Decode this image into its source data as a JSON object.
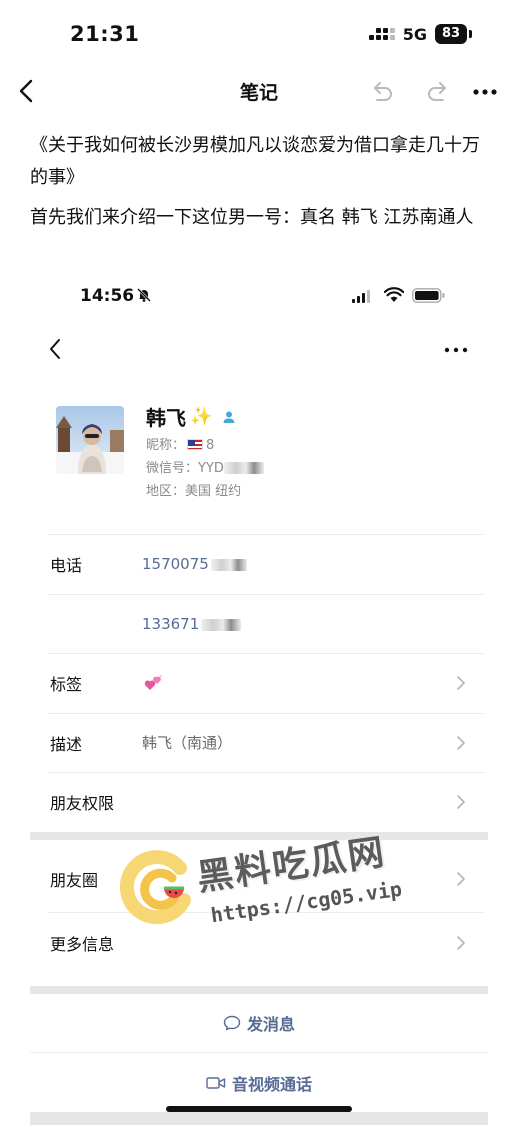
{
  "status_bar": {
    "time": "21:31",
    "network": "5G",
    "battery": "83"
  },
  "nav": {
    "title": "笔记"
  },
  "note": {
    "line1": "《关于我如何被长沙男模加凡以谈恋爱为借口拿走几十万的事》",
    "line2": "首先我们来介绍一下这位男一号：真名 韩飞 江苏南通人"
  },
  "inner_status": {
    "time": "14:56"
  },
  "profile": {
    "name": "韩飞",
    "sparkle": "✨",
    "nickname_label": "昵称：",
    "nickname_value": "8",
    "wechat_label": "微信号：",
    "wechat_value": "YYD",
    "region_label": "地区：",
    "region_value": "美国 纽约"
  },
  "rows": {
    "phone_label": "电话",
    "phone1": "1570075",
    "phone2": "133671",
    "tags_label": "标签",
    "desc_label": "描述",
    "desc_value": "韩飞（南通）",
    "permission_label": "朋友权限",
    "moments_label": "朋友圈",
    "more_label": "更多信息"
  },
  "actions": {
    "message": "发消息",
    "call": "音视频通话"
  },
  "watermark": {
    "title": "黑料吃瓜网",
    "url": "https://cg05.vip"
  },
  "colors": {
    "link": "#576b95",
    "separator": "#e6e6e6"
  }
}
